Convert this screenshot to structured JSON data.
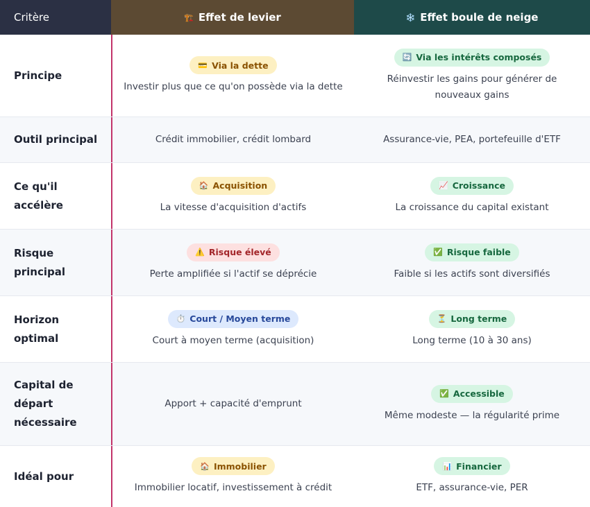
{
  "header": {
    "criteria": "Critère",
    "lever": {
      "icon": "🏗️",
      "label": "Effet de levier"
    },
    "snowball": {
      "icon": "❄️",
      "label": "Effet boule de neige"
    }
  },
  "rows": [
    {
      "criterion": "Principe",
      "lever": {
        "badge": {
          "icon": "💳",
          "text": "Via la dette"
        },
        "text": "Investir plus que ce qu'on possède via la dette"
      },
      "snowball": {
        "badge": {
          "icon": "🔄",
          "text": "Via les intérêts composés"
        },
        "text": "Réinvestir les gains pour générer de nouveaux gains"
      }
    },
    {
      "criterion": "Outil principal",
      "lever": {
        "text": "Crédit immobilier, crédit lombard"
      },
      "snowball": {
        "text": "Assurance-vie, PEA, portefeuille d'ETF"
      }
    },
    {
      "criterion": "Ce qu'il accélère",
      "lever": {
        "badge": {
          "icon": "🏠",
          "text": "Acquisition"
        },
        "text": "La vitesse d'acquisition d'actifs"
      },
      "snowball": {
        "badge": {
          "icon": "📈",
          "text": "Croissance"
        },
        "text": "La croissance du capital existant"
      }
    },
    {
      "criterion": "Risque principal",
      "lever": {
        "badge": {
          "icon": "⚠️",
          "text": "Risque élevé"
        },
        "text": "Perte amplifiée si l'actif se déprécie"
      },
      "snowball": {
        "badge": {
          "icon": "✅",
          "text": "Risque faible"
        },
        "text": "Faible si les actifs sont diversifiés"
      }
    },
    {
      "criterion": "Horizon optimal",
      "lever": {
        "badge": {
          "icon": "⏱️",
          "text": "Court / Moyen terme"
        },
        "text": "Court à moyen terme (acquisition)"
      },
      "snowball": {
        "badge": {
          "icon": "⏳",
          "text": "Long terme"
        },
        "text": "Long terme (10 à 30 ans)"
      }
    },
    {
      "criterion": "Capital de départ nécessaire",
      "lever": {
        "text": "Apport + capacité d'emprunt"
      },
      "snowball": {
        "badge": {
          "icon": "✅",
          "text": "Accessible"
        },
        "text": "Même modeste — la régularité prime"
      }
    },
    {
      "criterion": "Idéal pour",
      "lever": {
        "badge": {
          "icon": "🏠",
          "text": "Immobilier"
        },
        "text": "Immobilier locatif, investissement à crédit"
      },
      "snowball": {
        "badge": {
          "icon": "📊",
          "text": "Financier"
        },
        "text": "ETF, assurance-vie, PER"
      }
    }
  ],
  "colors": {
    "header_criteria_bg": "#2b3044",
    "header_lever_bg": "#5c4a33",
    "header_snowball_bg": "#1e4a49",
    "divider_accent": "#c2336a"
  }
}
